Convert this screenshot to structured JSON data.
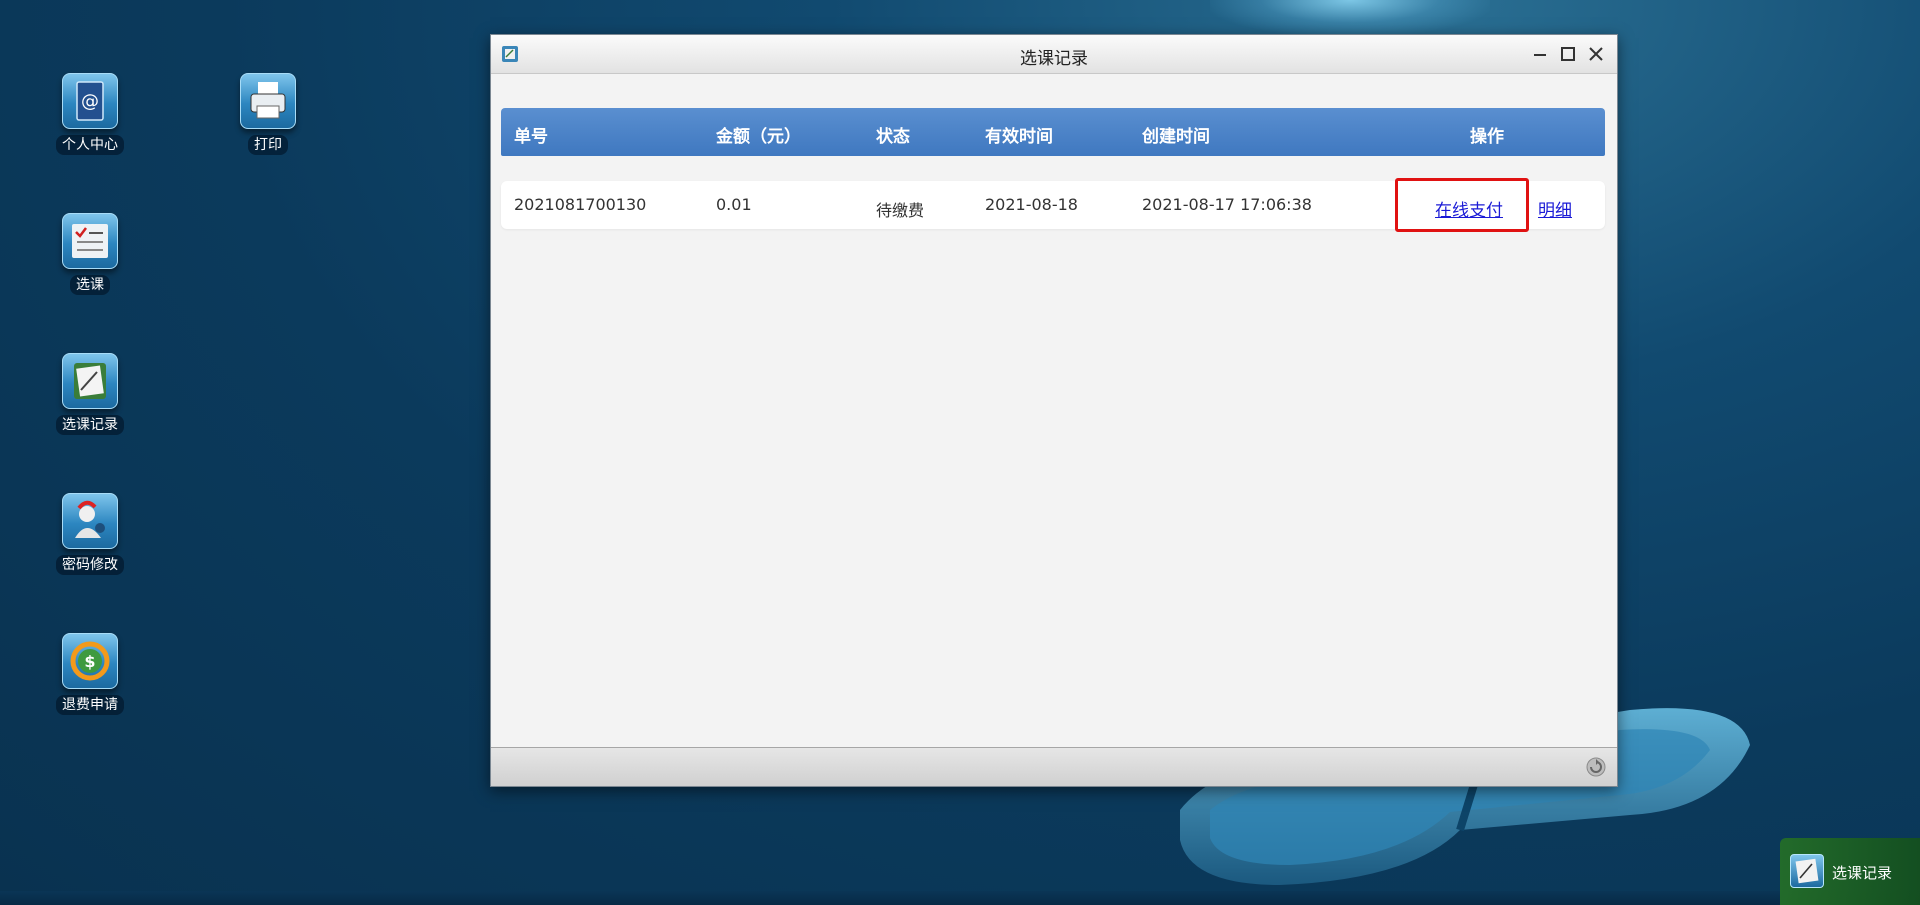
{
  "desktop": {
    "icons": [
      {
        "label": "个人中心",
        "icon": "address-book-icon"
      },
      {
        "label": "打印",
        "icon": "printer-icon"
      },
      {
        "label": "选课",
        "icon": "checklist-icon"
      },
      {
        "label": "选课记录",
        "icon": "notepad-icon"
      },
      {
        "label": "密码修改",
        "icon": "user-key-icon"
      },
      {
        "label": "退费申请",
        "icon": "dollar-refund-icon"
      }
    ]
  },
  "window": {
    "title": "选课记录",
    "table": {
      "columns": [
        "单号",
        "金额（元）",
        "状态",
        "有效时间",
        "创建时间",
        "操作"
      ],
      "rows": [
        {
          "order_no": "2021081700130",
          "amount": "0.01",
          "status": "待缴费",
          "valid_date": "2021-08-18",
          "created_at": "2021-08-17 17:06:38",
          "actions": [
            "在线支付",
            "明细"
          ]
        }
      ]
    }
  },
  "taskbar": {
    "items": [
      {
        "label": "选课记录",
        "icon": "notepad-icon"
      }
    ]
  },
  "colors": {
    "header_blue": "#4a82c8",
    "link_blue": "#1a1ad6",
    "highlight_red": "#e01212",
    "taskbar_green": "#246e28"
  }
}
